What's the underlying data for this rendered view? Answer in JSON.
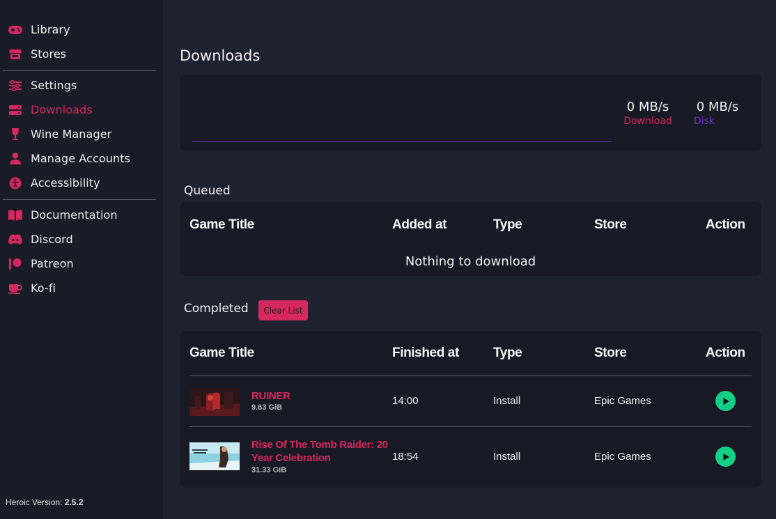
{
  "sidebar": {
    "group1": [
      {
        "label": "Library",
        "icon": "gamepad-icon"
      },
      {
        "label": "Stores",
        "icon": "store-icon"
      }
    ],
    "group2": [
      {
        "label": "Settings",
        "icon": "sliders-icon"
      },
      {
        "label": "Downloads",
        "icon": "hard-drive-icon",
        "active": true
      },
      {
        "label": "Wine Manager",
        "icon": "wine-glass-icon"
      },
      {
        "label": "Manage Accounts",
        "icon": "user-icon"
      },
      {
        "label": "Accessibility",
        "icon": "accessibility-icon"
      }
    ],
    "group3": [
      {
        "label": "Documentation",
        "icon": "book-icon"
      },
      {
        "label": "Discord",
        "icon": "discord-icon"
      },
      {
        "label": "Patreon",
        "icon": "patreon-icon"
      },
      {
        "label": "Ko-fi",
        "icon": "coffee-cup-icon"
      }
    ],
    "version_label": "Heroic Version:",
    "version_value": "2.5.2"
  },
  "page": {
    "title": "Downloads"
  },
  "stats": {
    "download_value": "0 MB/s",
    "download_label": "Download",
    "disk_value": "0 MB/s",
    "disk_label": "Disk"
  },
  "queued": {
    "title": "Queued",
    "columns": [
      "Game Title",
      "Added at",
      "Type",
      "Store",
      "Action"
    ],
    "empty_text": "Nothing to download"
  },
  "completed": {
    "title": "Completed",
    "clear_label": "Clear List",
    "columns": [
      "Game Title",
      "Finished at",
      "Type",
      "Store",
      "Action"
    ],
    "rows": [
      {
        "title": "RUINER",
        "size": "9.63 GiB",
        "finished": "14:00",
        "type": "Install",
        "store": "Epic Games"
      },
      {
        "title": "Rise Of The Tomb Raider: 20 Year Celebration",
        "size": "31.33 GiB",
        "finished": "18:54",
        "type": "Install",
        "store": "Epic Games"
      }
    ]
  },
  "colors": {
    "accent": "#d4285e",
    "disk": "#6c2ec2",
    "play": "#14cf86",
    "sidebar_bg": "#191b26",
    "main_bg": "#1e2130",
    "card_bg": "#171a25"
  }
}
